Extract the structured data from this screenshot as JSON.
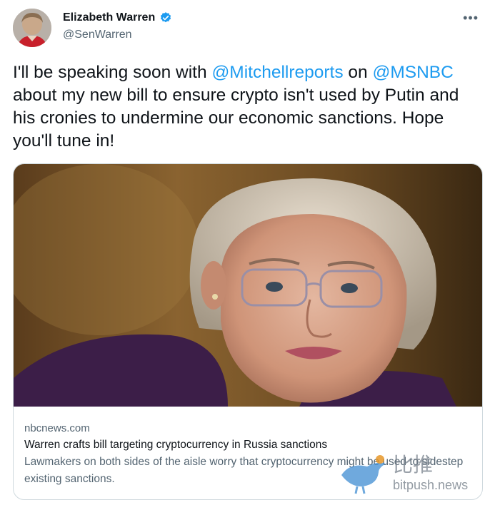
{
  "author": {
    "display_name": "Elizabeth Warren",
    "handle": "@SenWarren",
    "verified_icon": "verified-badge-icon"
  },
  "menu": {
    "more_label": "•••"
  },
  "tweet": {
    "text_part1": "I'll be speaking soon with ",
    "mention1": "@Mitchellreports",
    "text_part2": " on ",
    "mention2": "@MSNBC",
    "text_part3": " about my new bill to ensure crypto isn't used by Putin and his cronies to undermine our economic sanctions. Hope you'll tune in!"
  },
  "card": {
    "domain": "nbcnews.com",
    "title": "Warren crafts bill targeting cryptocurrency in Russia sanctions",
    "description": "Lawmakers on both sides of the aisle worry that cryptocurrency might be used to sidestep existing sanctions."
  },
  "watermark": {
    "brand_cn": "比推",
    "brand_en": "bitpush.news"
  },
  "colors": {
    "link": "#1d9bf0",
    "text_primary": "#0f1419",
    "text_secondary": "#536471",
    "border": "#cfd9de"
  }
}
